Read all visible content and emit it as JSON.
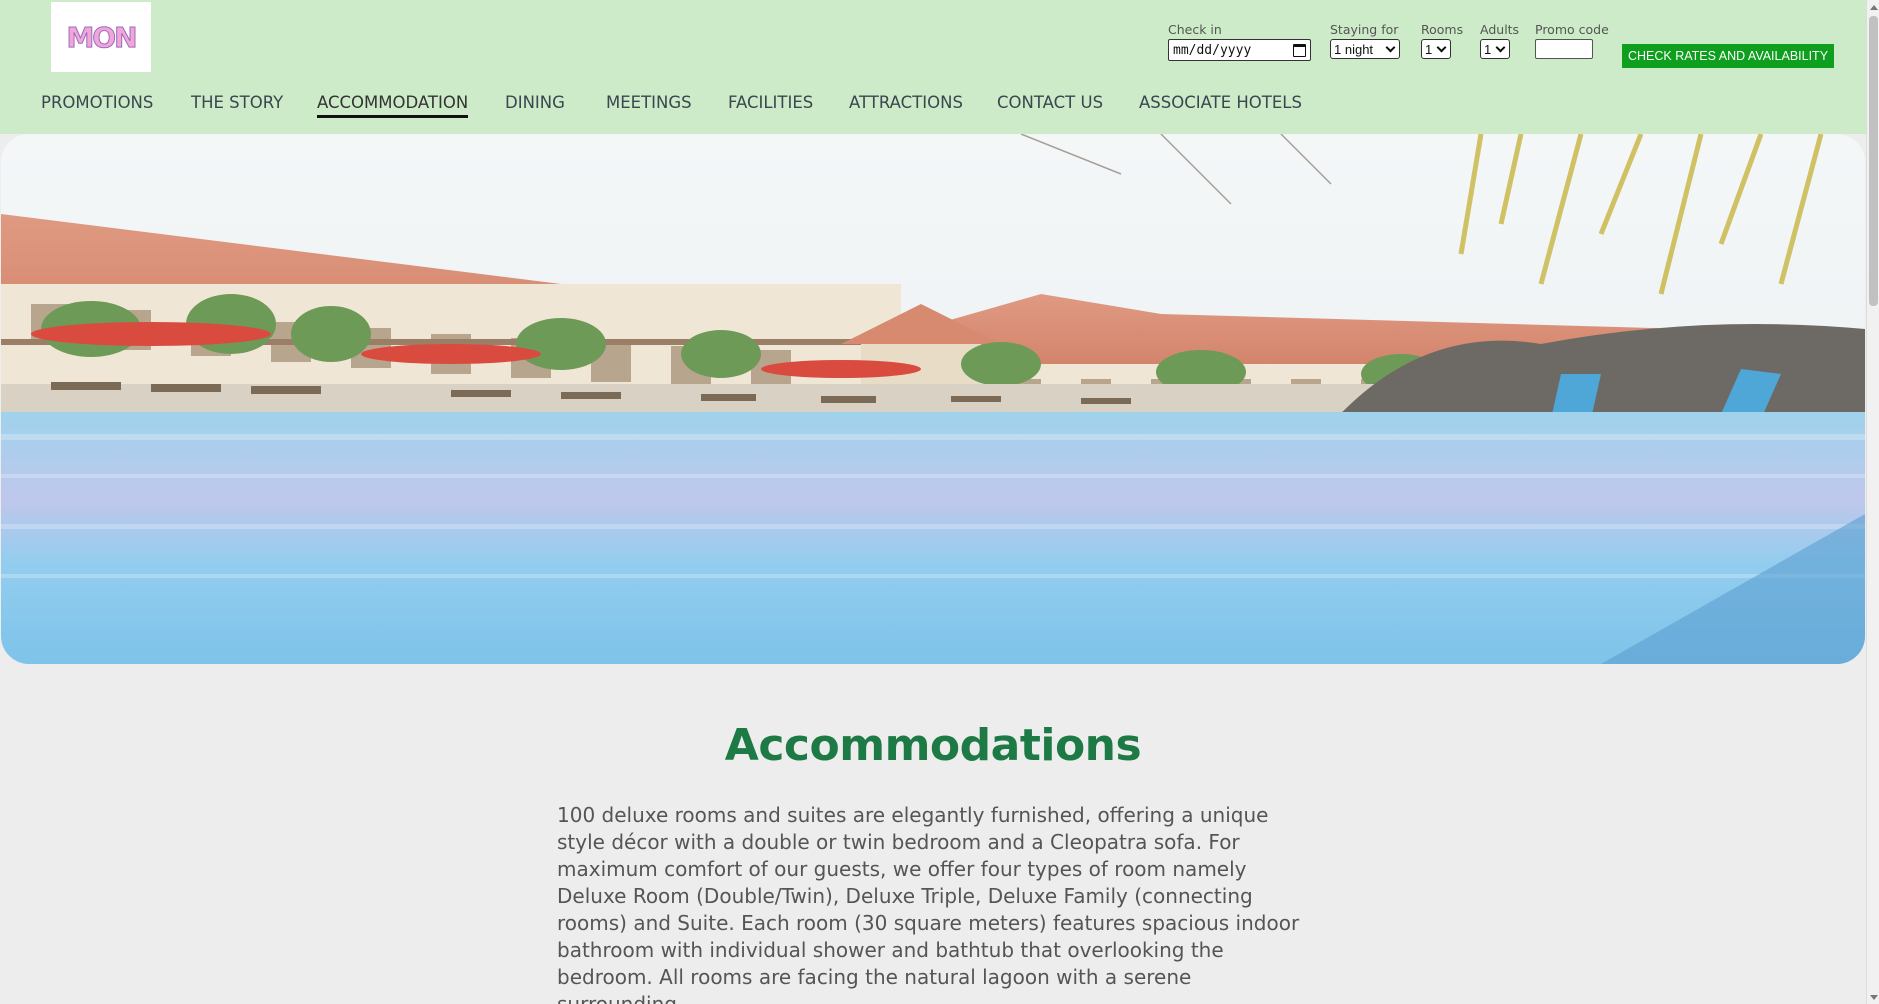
{
  "logo": {
    "text": "MON"
  },
  "booking": {
    "checkin_label": "Check in",
    "checkin_value": "mm/dd/yyyy",
    "staying_label": "Staying for",
    "staying_value": "1 night",
    "rooms_label": "Rooms",
    "rooms_value": "1",
    "adults_label": "Adults",
    "adults_value": "1",
    "promo_label": "Promo code",
    "promo_value": "",
    "submit_label": "CHECK RATES AND AVAILABILITY"
  },
  "nav": {
    "items": [
      {
        "label": "PROMOTIONS"
      },
      {
        "label": "THE STORY"
      },
      {
        "label": "ACCOMMODATION"
      },
      {
        "label": "DINING"
      },
      {
        "label": "MEETINGS"
      },
      {
        "label": "FACILITIES"
      },
      {
        "label": "ATTRACTIONS"
      },
      {
        "label": "CONTACT US"
      },
      {
        "label": "ASSOCIATE HOTELS"
      }
    ],
    "active": "ACCOMMODATION"
  },
  "content": {
    "title": "Accommodations",
    "body": "100 deluxe rooms and suites are elegantly furnished, offering a unique style décor with a double or twin bedroom and a Cleopatra sofa. For maximum comfort of our guests, we offer four types of room namely Deluxe Room (Double/Twin), Deluxe Triple, Deluxe Family (connecting rooms) and Suite. Each room (30 square meters) features spacious indoor bathroom with individual shower and bathtub that overlooking the bedroom. All rooms are facing the natural lagoon with a serene surrounding."
  },
  "colors": {
    "header_bg": "#cdebc8",
    "accent_button": "#0e9f1e",
    "title_green": "#1e7a45",
    "page_bg": "#ededed"
  },
  "icons": {
    "calendar": "calendar-icon",
    "dropdown": "chevron-down-icon"
  }
}
